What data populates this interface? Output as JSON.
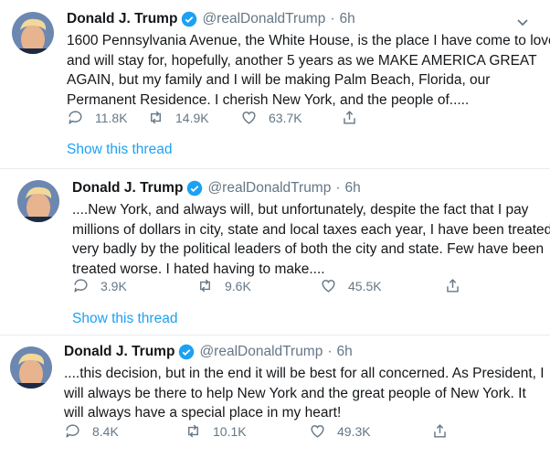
{
  "colors": {
    "accent": "#1da1f2",
    "muted": "#657786",
    "text": "#14171a",
    "divider": "#e6ecf0"
  },
  "tweets": [
    {
      "name": "Donald J. Trump",
      "handle": "@realDonaldTrump",
      "sep": "·",
      "time": "6h",
      "lines": [
        "1600 Pennsylvania Avenue, the White House, is the place I have come to love",
        "and will stay for, hopefully, another 5 years as we MAKE AMERICA GREAT",
        "AGAIN, but my family and I will be making Palm Beach, Florida, our",
        "Permanent Residence. I cherish New York, and the people of....."
      ],
      "replies": "11.8K",
      "retweets": "14.9K",
      "likes": "63.7K",
      "thread_link": "Show this thread"
    },
    {
      "name": "Donald J. Trump",
      "handle": "@realDonaldTrump",
      "sep": "·",
      "time": "6h",
      "lines": [
        "....New York, and always will, but unfortunately, despite the fact that I pay",
        "millions of dollars in city, state and local taxes each year, I have been treated",
        "very badly by the political leaders of both the city and state. Few have been",
        "treated worse. I hated having to make...."
      ],
      "replies": "3.9K",
      "retweets": "9.6K",
      "likes": "45.5K",
      "thread_link": "Show this thread"
    },
    {
      "name": "Donald J. Trump",
      "handle": "@realDonaldTrump",
      "sep": "·",
      "time": "6h",
      "lines": [
        "....this decision, but in the end it will be best for all concerned. As President, I",
        "will always be there to help New York and the great people of New York. It",
        "will always have a special place in my heart!"
      ],
      "replies": "8.4K",
      "retweets": "10.1K",
      "likes": "49.3K"
    }
  ]
}
